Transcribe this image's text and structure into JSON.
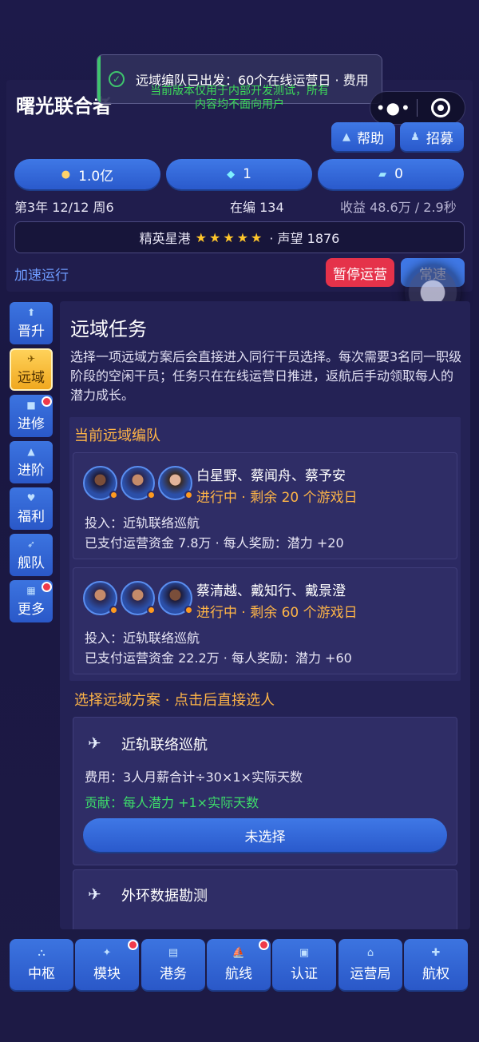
{
  "header": {
    "title": "曙光联合者",
    "toast_text": "远域编队已出发：60个在线运营日 · 费用",
    "dev_note": "当前版本仅用于内部开发测试，所有内容均不面向用户",
    "help_label": "帮助",
    "recruit_label": "招募"
  },
  "resources": {
    "money": "1.0亿",
    "gems": "1",
    "tickets": "0"
  },
  "status": {
    "date": "第3年 12/12 周6",
    "staff": "在编 134",
    "income": "收益 48.6万 / 2.9秒"
  },
  "port": {
    "name": "精英星港",
    "stars": "★★★★★",
    "fame": "· 声望 1876"
  },
  "controls": {
    "speed_up": "加速运行",
    "pause": "暂停运营",
    "normal": "常速"
  },
  "sidebar": {
    "items": [
      {
        "label": "晋升",
        "icon": "upgrade-icon"
      },
      {
        "label": "远域",
        "icon": "expedition-icon"
      },
      {
        "label": "进修",
        "icon": "study-icon"
      },
      {
        "label": "进阶",
        "icon": "advance-icon"
      },
      {
        "label": "福利",
        "icon": "welfare-icon"
      },
      {
        "label": "舰队",
        "icon": "fleet-icon"
      },
      {
        "label": "更多",
        "icon": "more-icon"
      }
    ]
  },
  "main": {
    "title": "远域任务",
    "description": "选择一项远域方案后会直接进入同行干员选择。每次需要3名同一职级阶段的空闲干员；任务只在在线运营日推进，返航后手动领取每人的潜力成长。",
    "current_section": "当前远域编队",
    "missions": [
      {
        "crew": "白星野、蔡闻舟、蔡予安",
        "status": "进行中 · 剩余 20 个游戏日",
        "input": "投入：近轨联络巡航",
        "cost": "已支付运营资金 7.8万 · 每人奖励：潜力 +20"
      },
      {
        "crew": "蔡清越、戴知行、戴景澄",
        "status": "进行中 · 剩余 60 个游戏日",
        "input": "投入：近轨联络巡航",
        "cost": "已支付运营资金 22.2万 · 每人奖励：潜力 +60"
      }
    ],
    "plan_section": "选择远域方案 · 点击后直接选人",
    "plans": [
      {
        "name": "近轨联络巡航",
        "cost": "费用：3人月薪合计÷30×1×实际天数",
        "reward": "贡献：每人潜力 +1×实际天数",
        "button": "未选择"
      },
      {
        "name": "外环数据勘测"
      }
    ]
  },
  "tabbar": {
    "items": [
      {
        "label": "中枢",
        "icon": "hub-icon"
      },
      {
        "label": "模块",
        "icon": "module-icon"
      },
      {
        "label": "港务",
        "icon": "port-icon"
      },
      {
        "label": "航线",
        "icon": "route-icon"
      },
      {
        "label": "认证",
        "icon": "cert-icon"
      },
      {
        "label": "运营局",
        "icon": "bureau-icon"
      },
      {
        "label": "航权",
        "icon": "rights-icon"
      }
    ]
  },
  "colors": {
    "accent_blue": "#3f78e6",
    "highlight_gold": "#ffb547",
    "danger_red": "#e5324a",
    "success_green": "#3ddc5a"
  }
}
